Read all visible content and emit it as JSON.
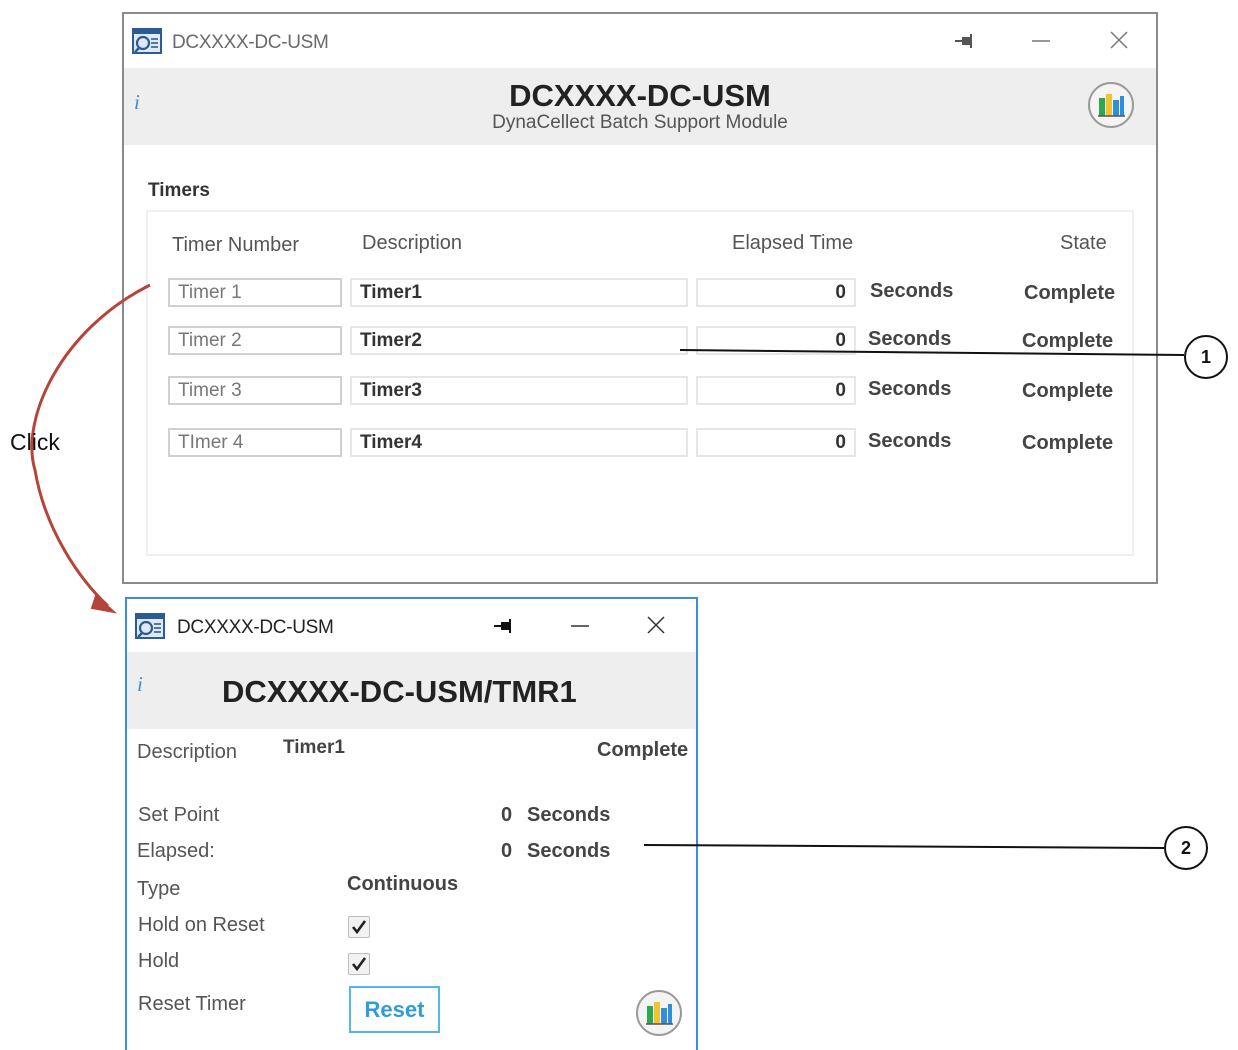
{
  "main_window": {
    "title": "DCXXXX-DC-USM",
    "header_title": "DCXXXX-DC-USM",
    "header_subtitle": "DynaCellect Batch Support Module",
    "info_glyph": "i",
    "section_title": "Timers",
    "columns": {
      "timer_number": "Timer Number",
      "description": "Description",
      "elapsed_time": "Elapsed Time",
      "state": "State"
    },
    "timers": [
      {
        "number": "Timer 1",
        "description": "Timer1",
        "elapsed": "0",
        "unit": "Seconds",
        "state": "Complete"
      },
      {
        "number": "Timer 2",
        "description": "Timer2",
        "elapsed": "0",
        "unit": "Seconds",
        "state": "Complete"
      },
      {
        "number": "Timer 3",
        "description": "Timer3",
        "elapsed": "0",
        "unit": "Seconds",
        "state": "Complete"
      },
      {
        "number": "TImer 4",
        "description": "Timer4",
        "elapsed": "0",
        "unit": "Seconds",
        "state": "Complete"
      }
    ]
  },
  "detail_window": {
    "title": "DCXXXX-DC-USM",
    "header_title": "DCXXXX-DC-USM/TMR1",
    "info_glyph": "i",
    "description_label": "Description",
    "description_value": "Timer1",
    "state_value": "Complete",
    "set_point_label": "Set Point",
    "set_point_value": "0",
    "set_point_unit": "Seconds",
    "elapsed_label": "Elapsed:",
    "elapsed_value": "0",
    "elapsed_unit": "Seconds",
    "type_label": "Type",
    "type_value": "Continuous",
    "hold_on_reset_label": "Hold on Reset",
    "hold_on_reset_checked": true,
    "hold_label": "Hold",
    "hold_checked": true,
    "reset_timer_label": "Reset Timer",
    "reset_button": "Reset"
  },
  "annotations": {
    "click_label": "Click",
    "callout_1": "1",
    "callout_2": "2"
  },
  "icons": [
    "app-window-icon",
    "pin-icon",
    "minimize-icon",
    "close-icon",
    "chart-icon",
    "info-icon",
    "checkmark-icon"
  ],
  "colors": {
    "header_bg": "#eeeeee",
    "accent_blue": "#3a8fd6",
    "reset_blue": "#2f9ed8",
    "arrow_red": "#b5453a"
  }
}
